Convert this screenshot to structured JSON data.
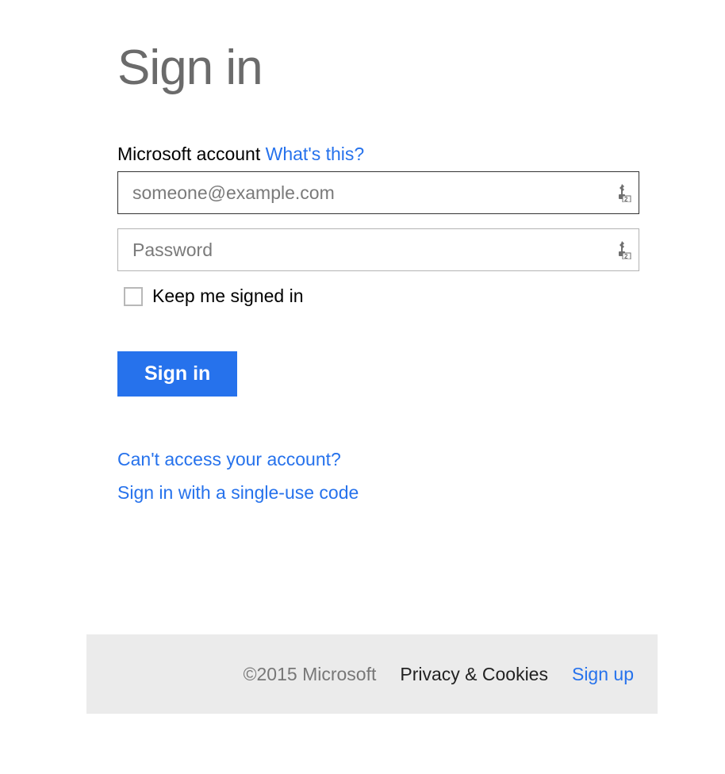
{
  "page": {
    "title": "Sign in"
  },
  "form": {
    "account_label": "Microsoft account",
    "whats_this_link": "What's this?",
    "username": {
      "placeholder": "someone@example.com",
      "value": ""
    },
    "password": {
      "placeholder": "Password",
      "value": ""
    },
    "keep_signed_in_label": "Keep me signed in",
    "submit_label": "Sign in"
  },
  "links": {
    "cant_access": "Can't access your account?",
    "single_use_code": "Sign in with a single-use code"
  },
  "footer": {
    "copyright": "©2015 Microsoft",
    "privacy": "Privacy & Cookies",
    "signup": "Sign up"
  }
}
